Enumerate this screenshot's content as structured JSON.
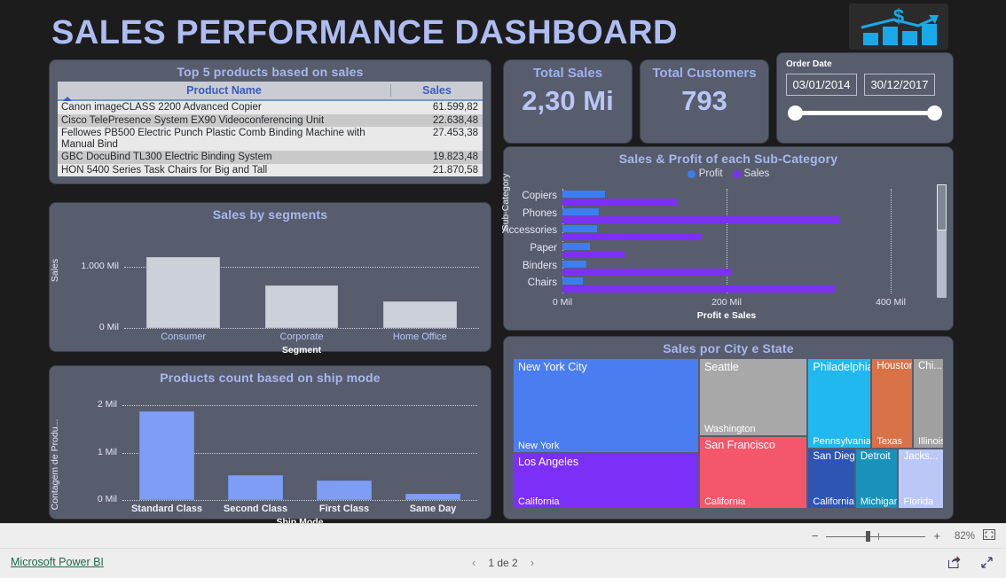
{
  "header": {
    "title": "SALES PERFORMANCE DASHBOARD",
    "logo_icon": "bar-chart-dollar-logo"
  },
  "top_products": {
    "title": "Top 5 products based on sales",
    "columns": [
      "Product Name",
      "Sales"
    ],
    "sort_icon": "sort-ascending-triangle-icon",
    "rows": [
      {
        "name": "Canon imageCLASS 2200 Advanced Copier",
        "sales": "61.599,82"
      },
      {
        "name": "Cisco TelePresence System EX90 Videoconferencing Unit",
        "sales": "22.638,48"
      },
      {
        "name": "Fellowes PB500 Electric Punch Plastic Comb Binding Machine with Manual Bind",
        "sales": "27.453,38"
      },
      {
        "name": "GBC DocuBind TL300 Electric Binding System",
        "sales": "19.823,48"
      },
      {
        "name": "HON 5400 Series Task Chairs for Big and Tall",
        "sales": "21.870,58"
      }
    ]
  },
  "kpis": {
    "total_sales": {
      "label": "Total Sales",
      "value": "2,30 Mi"
    },
    "total_customers": {
      "label": "Total Customers",
      "value": "793"
    }
  },
  "slicer": {
    "label": "Order Date",
    "start": "03/01/2014",
    "end": "30/12/2017"
  },
  "treemap": {
    "title": "Sales por City e State",
    "tiles": [
      {
        "city": "New York City",
        "state": "New York",
        "color": "#4a7ef0"
      },
      {
        "city": "Los Angeles",
        "state": "California",
        "color": "#7b2ff7"
      },
      {
        "city": "Seattle",
        "state": "Washington",
        "color": "#a8a8a8"
      },
      {
        "city": "San Francisco",
        "state": "California",
        "color": "#f4566b"
      },
      {
        "city": "Philadelphia",
        "state": "Pennsylvania",
        "color": "#21b8ef"
      },
      {
        "city": "Houston",
        "state": "Texas",
        "color": "#da7247"
      },
      {
        "city": "Chi...",
        "state": "Illinois",
        "color": "#a0a0a0"
      },
      {
        "city": "San Diego",
        "state": "California",
        "color": "#2e55b4"
      },
      {
        "city": "Detroit",
        "state": "Michigan",
        "color": "#1a91bb"
      },
      {
        "city": "Jacks...",
        "state": "Florida",
        "color": "#bac7f7"
      }
    ]
  },
  "footer": {
    "link": "Microsoft Power BI",
    "page": "1 de 2",
    "prev_icon": "chevron-left-icon",
    "next_icon": "chevron-right-icon",
    "share_icon": "share-icon",
    "fullscreen_icon": "fullscreen-icon",
    "zoom_minus": "−",
    "zoom_plus": "+",
    "zoom_percent": "82%",
    "fit_icon": "fit-to-page-icon"
  },
  "chart_data": [
    {
      "type": "bar",
      "orientation": "horizontal",
      "title": "Sales & Profit of each Sub-Category",
      "xlabel": "Profit e Sales",
      "ylabel": "Sub-Category",
      "categories": [
        "Copiers",
        "Phones",
        "Accessories",
        "Paper",
        "Binders",
        "Chairs"
      ],
      "series": [
        {
          "name": "Profit",
          "color": "#3a7ff0",
          "values": [
            52,
            44,
            42,
            33,
            29,
            25
          ]
        },
        {
          "name": "Sales",
          "color": "#7b2ff7",
          "values": [
            140,
            337,
            170,
            76,
            205,
            332
          ]
        }
      ],
      "xlim": [
        0,
        400
      ],
      "xticks": [
        "0 Mil",
        "200 Mil",
        "400 Mil"
      ],
      "grid": true,
      "legend_position": "top",
      "scrollbar": "vertical"
    },
    {
      "type": "bar",
      "orientation": "vertical",
      "title": "Sales by segments",
      "xlabel": "Segment",
      "ylabel": "Sales",
      "categories": [
        "Consumer",
        "Corporate",
        "Home Office"
      ],
      "values": [
        1160,
        700,
        430
      ],
      "ylim": [
        0,
        1250
      ],
      "yticks": [
        "1.000 Mil",
        "0 Mil"
      ],
      "bar_color": "#ccd0d8",
      "grid": true
    },
    {
      "type": "bar",
      "orientation": "vertical",
      "title": "Products count based on ship mode",
      "xlabel": "Ship Mode",
      "ylabel": "Contagem de Produ...",
      "categories": [
        "Standard Class",
        "Second Class",
        "First Class",
        "Same Day"
      ],
      "values": [
        1.87,
        0.53,
        0.42,
        0.13
      ],
      "ylim": [
        0,
        2.15
      ],
      "yticks": [
        "2 Mil",
        "1 Mil",
        "0 Mil"
      ],
      "bar_color": "#7f9df4",
      "grid": true
    }
  ]
}
